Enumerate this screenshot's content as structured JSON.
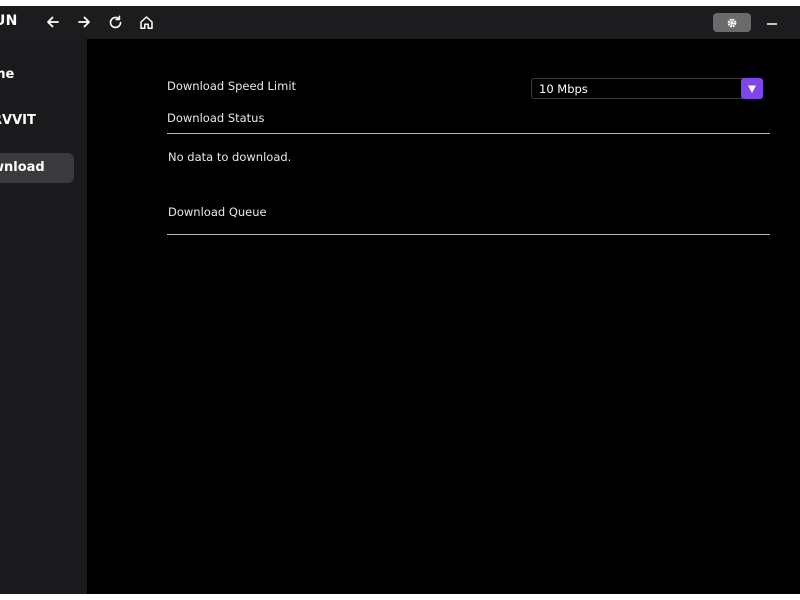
{
  "titlebar": {
    "app_title": "UN",
    "icons": {
      "back": "arrow-left-icon",
      "forward": "arrow-right-icon",
      "reload": "reload-icon",
      "home": "home-icon",
      "settings": "gear-icon",
      "minimize": "minimize-icon"
    }
  },
  "sidebar": {
    "items": [
      {
        "label": "me"
      },
      {
        "label": "RVVIT"
      },
      {
        "label": "wnload"
      }
    ],
    "active_index": 2
  },
  "main": {
    "speed_limit_label": "Download Speed Limit",
    "speed_limit_select": {
      "value": "10 Mbps"
    },
    "status_label": "Download Status",
    "status_message": "No data to download.",
    "queue_label": "Download Queue"
  },
  "colors": {
    "accent": "#7d45ea",
    "background": "#000000",
    "sidebar": "#1b1b1d",
    "titlebar": "#1c1c1e"
  }
}
